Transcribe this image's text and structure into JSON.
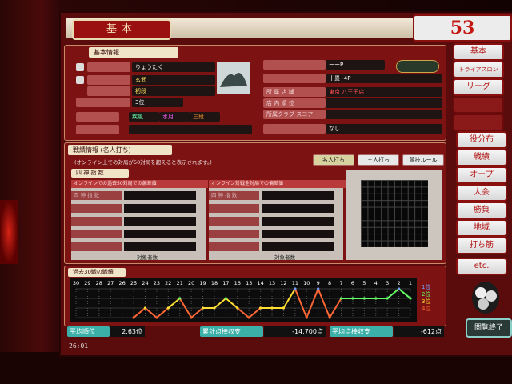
{
  "header": {
    "title": "基本",
    "counter": "53"
  },
  "basic_info": {
    "section_title": "基本情報",
    "name": "りょうたく",
    "dan1": "玄武",
    "dan2": "初段",
    "row3": "3位",
    "badge1": "疾風",
    "badge2": "水月",
    "badge3": "三段"
  },
  "right_info": {
    "rows": [
      {
        "label": "",
        "value": "ーーP"
      },
      {
        "label": "",
        "value": "十畳 -4P"
      },
      {
        "label": "所 属 店 舗",
        "value": "東京 八王子店"
      },
      {
        "label": "店 内 順 位",
        "value": ""
      },
      {
        "label": "所属クラブ スコア",
        "value": ""
      },
      {
        "label": "",
        "value": "なし"
      }
    ]
  },
  "side_menu": [
    "基本",
    "トライアスロン",
    "リーグ",
    "",
    "役分布",
    "戦績",
    "オープ",
    "大会",
    "勝負",
    "地域",
    "打ち筋",
    "etc."
  ],
  "record": {
    "section_title": "戦績情報",
    "sub": "(名人打ち)",
    "notice": "(オンライン上での対局が50対局を超えると表示されます。)",
    "tabs": [
      "名人打ち",
      "三人打ち",
      "競技ルール"
    ],
    "subhead": "四 神 指 数",
    "left_caption": "オンラインでの過去50対局での偏差値",
    "right_caption": "オンライン対戦全対局での偏差値",
    "rows_left": [
      "四 神 指 数",
      "",
      "",
      "",
      ""
    ],
    "rows_right": [
      "四 神 指 数",
      "",
      "",
      "",
      ""
    ],
    "footer_label": "対象者数"
  },
  "chart": {
    "title": "過去30戦の戦績",
    "x_ticks": [
      "30",
      "29",
      "28",
      "27",
      "26",
      "25",
      "24",
      "23",
      "22",
      "21",
      "20",
      "19",
      "18",
      "17",
      "16",
      "15",
      "14",
      "13",
      "12",
      "11",
      "10",
      "9",
      "8",
      "7",
      "6",
      "5",
      "4",
      "3",
      "2",
      "1"
    ],
    "legend": [
      "1位",
      "2位",
      "3位",
      "4位"
    ]
  },
  "chart_data": {
    "type": "line",
    "x": [
      30,
      29,
      28,
      27,
      26,
      25,
      24,
      23,
      22,
      21,
      20,
      19,
      18,
      17,
      16,
      15,
      14,
      13,
      12,
      11,
      10,
      9,
      8,
      7,
      6,
      5,
      4,
      3,
      2,
      1
    ],
    "series": [
      {
        "values": [
          null,
          null,
          null,
          null,
          null,
          4,
          3,
          4,
          3,
          2,
          4,
          3,
          3,
          2,
          3,
          4,
          3,
          3,
          3,
          1,
          4,
          1,
          4,
          2,
          2,
          2,
          2,
          2,
          1,
          2
        ]
      }
    ],
    "ylim": [
      1,
      4
    ]
  },
  "stats": {
    "avg_rank_label": "平均順位",
    "avg_rank": "2.63位",
    "total_label": "累計点棒収支",
    "total": "-14,700点",
    "avg_label": "平均点棒収支",
    "avg": "-612点"
  },
  "footer": {
    "close": "閲覧終了",
    "time": "26:01"
  }
}
